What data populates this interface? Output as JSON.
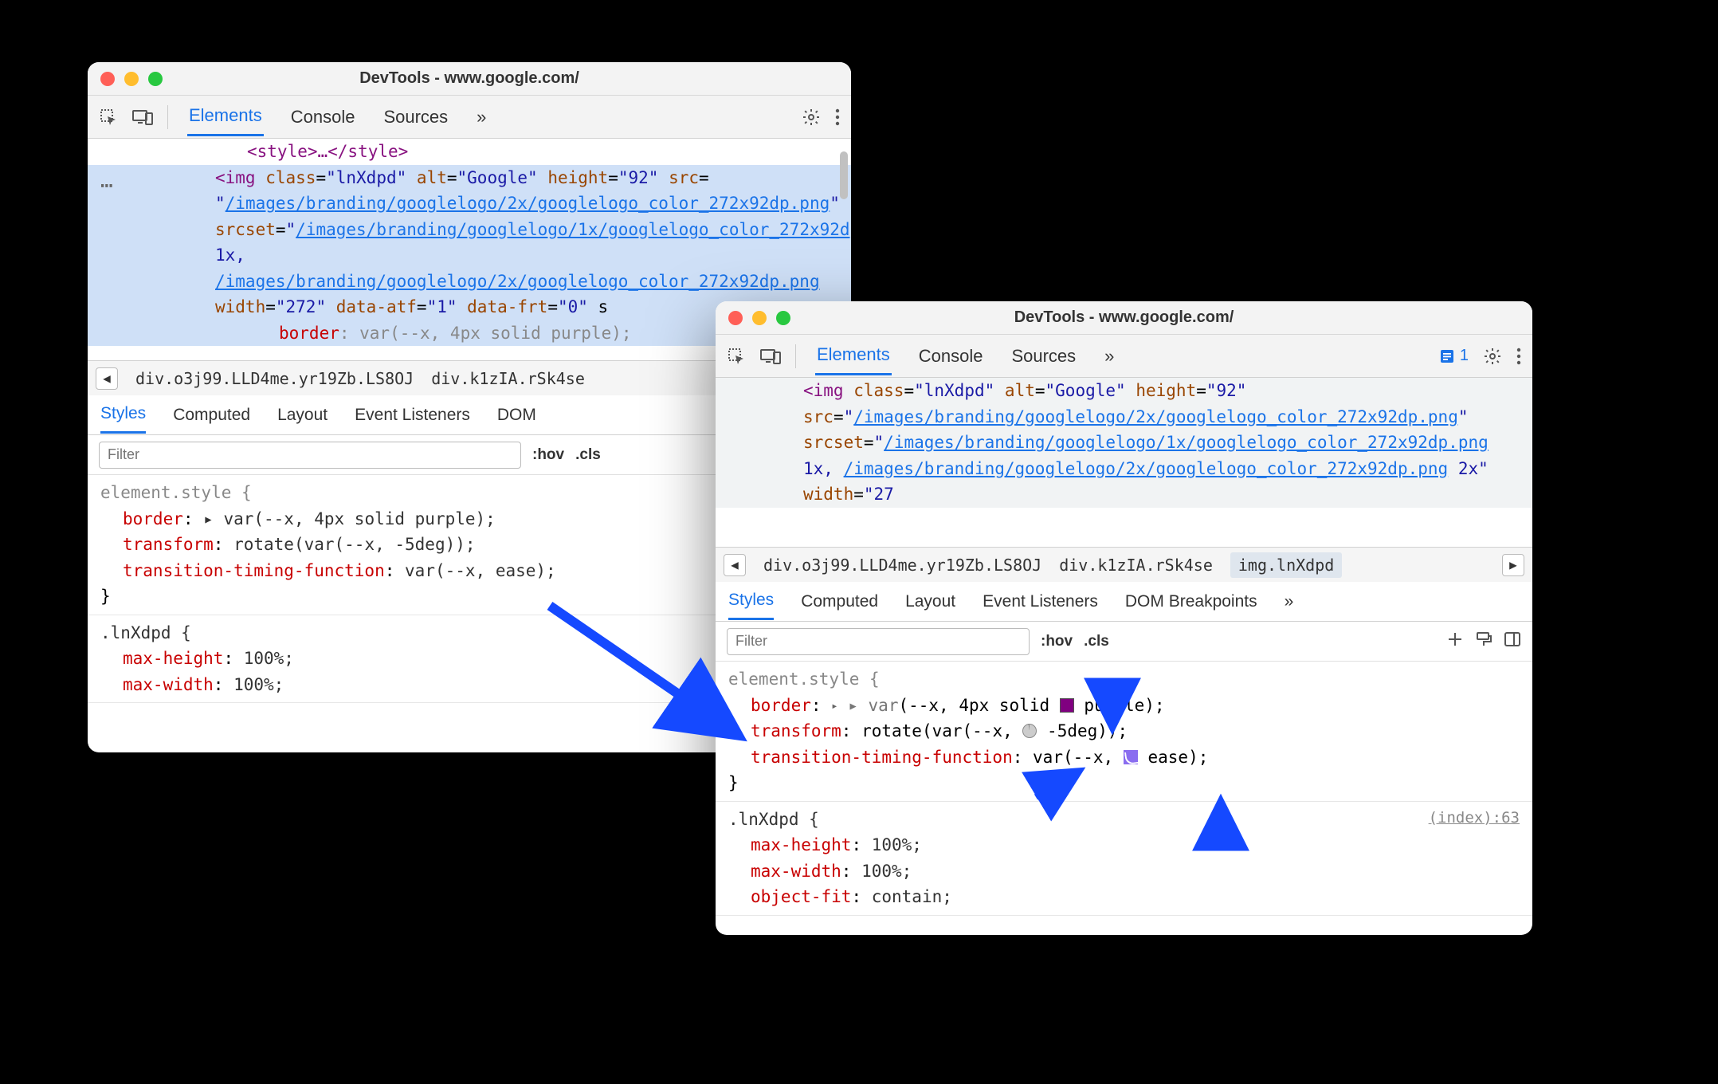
{
  "windows": {
    "a": {
      "title": "DevTools - www.google.com/"
    },
    "b": {
      "title": "DevTools - www.google.com/"
    }
  },
  "tabs": {
    "elements": "Elements",
    "console": "Console",
    "sources": "Sources",
    "more": "»"
  },
  "issues": {
    "count": "1"
  },
  "dom": {
    "style_close": "<style>…</style>",
    "img_open": "<img",
    "class_attr": "class",
    "class_val": "\"lnXdpd\"",
    "alt_attr": "alt",
    "alt_val": "\"Google\"",
    "height_attr": "height",
    "height_val": "\"92\"",
    "src_attr": "src",
    "src_eq": "=",
    "src_a_1": "\"",
    "src_a_link": "/images/branding/googlelogo/2x/googlelogo_color_272x92dp.png",
    "src_a_2": "\"",
    "srcset_attr": "srcset",
    "srcset_a_1": "\"",
    "srcset_a_link1": "/images/branding/googlelogo/1x/googlelogo_color_272x92dp.png",
    "srcset_a_mid": " 1x, ",
    "srcset_a_link2": "/images/branding/googlelogo/2x/googlelogo_color_272x92dp.png",
    "width_attr": "width",
    "width_val": "\"272\"",
    "dataatf_attr": "data-atf",
    "dataatf_val": "\"1\"",
    "datafrt_attr": "data-frt",
    "datafrt_val": "\"0\"",
    "inline_border": "border: var(--x, 4px solid purple);",
    "b_srcset_tail": " 2x\"",
    "b_width_val": "\"27"
  },
  "crumbs": {
    "c1": "div.o3j99.LLD4me.yr19Zb.LS8OJ",
    "c2": "div.k1zIA.rSk4se",
    "c3": "img.lnXdpd"
  },
  "subtabs": {
    "styles": "Styles",
    "computed": "Computed",
    "layout": "Layout",
    "listeners": "Event Listeners",
    "dombp": "DOM Breakpoints",
    "dombp_short": "DOM",
    "more": "»"
  },
  "filter": {
    "placeholder": "Filter",
    "hov": ":hov",
    "cls": ".cls"
  },
  "styles_panel": {
    "es_head": "element.style {",
    "border_k": "border",
    "border_v_a": "▸ var(--x, 4px solid purple);",
    "border_v_b_pre": "▸ var",
    "border_v_b_args_pre": "(--x, 4px solid ",
    "border_v_b_color": "purple",
    "border_v_b_post": ");",
    "transform_k": "transform",
    "transform_v_a": "rotate(var(--x, -5deg));",
    "transform_v_b_pre": "rotate(var(--x, ",
    "transform_v_b_val": "-5deg",
    "transform_v_b_post": "));",
    "ttf_k": "transition-timing-function",
    "ttf_v_a": "var(--x, ease);",
    "ttf_v_b_pre": "var(--x, ",
    "ttf_v_b_val": "ease",
    "ttf_v_b_post": ");",
    "close": "}",
    "lnxdpd_head": ".lnXdpd {",
    "maxh_k": "max-height",
    "maxh_v": "100%;",
    "maxw_k": "max-width",
    "maxw_v": "100%;",
    "objfit_k": "object-fit",
    "objfit_v": "contain;",
    "source": "(index):63"
  }
}
